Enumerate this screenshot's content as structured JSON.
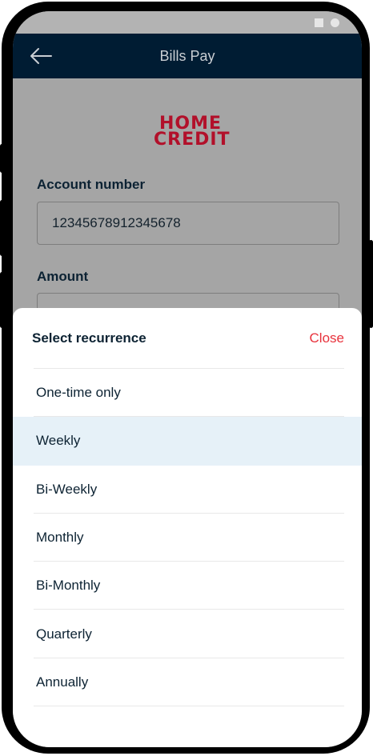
{
  "appbar": {
    "title": "Bills Pay"
  },
  "logo": {
    "line1": "HOME",
    "line2": "CREDIT"
  },
  "form": {
    "account_label": "Account number",
    "account_value": "12345678912345678",
    "amount_label": "Amount"
  },
  "sheet": {
    "title": "Select recurrence",
    "close_label": "Close",
    "selected_option": "Weekly",
    "options": [
      "One-time only",
      "Weekly",
      "Bi-Weekly",
      "Monthly",
      "Bi-Monthly",
      "Quarterly",
      "Annually"
    ]
  },
  "colors": {
    "appbar": "#001c33",
    "brand_red": "#b2102a",
    "close_red": "#e8323c",
    "selected_bg": "#e6f1f8"
  }
}
